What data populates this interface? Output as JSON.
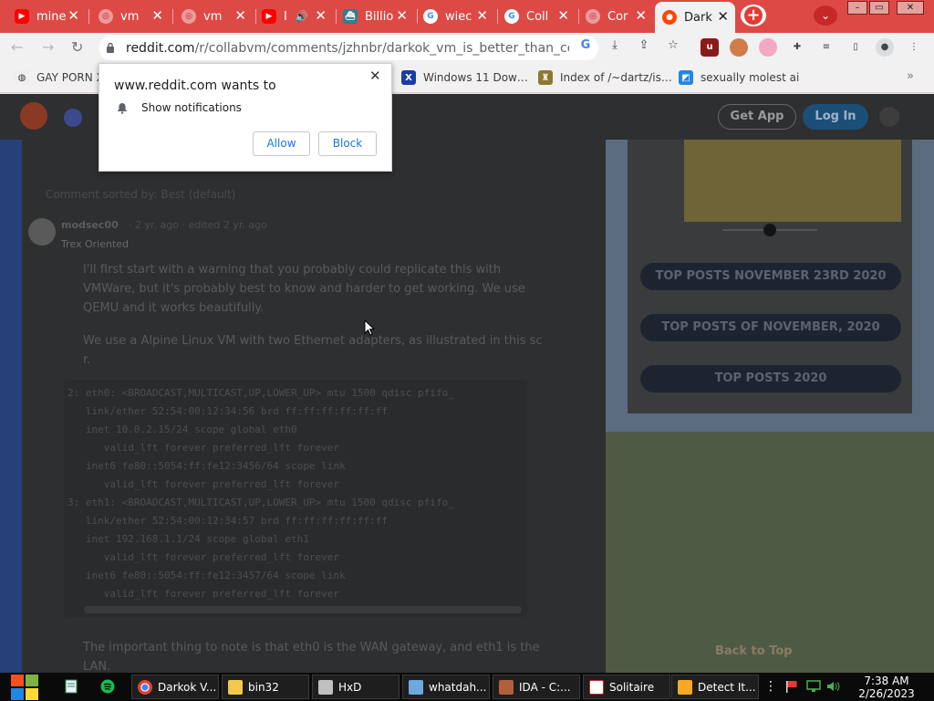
{
  "tabs": [
    {
      "label": "mine",
      "icon": "youtube-icon",
      "color": "#ff0000"
    },
    {
      "label": "vm",
      "icon": "generic-site-icon",
      "color": "#e57373"
    },
    {
      "label": "vm",
      "icon": "generic-site-icon",
      "color": "#e57373"
    },
    {
      "label": "I",
      "icon": "youtube-icon",
      "color": "#ff0000"
    },
    {
      "label": "Billio",
      "icon": "ship-icon",
      "color": "#2e7d91"
    },
    {
      "label": "wiec",
      "icon": "google-icon",
      "color": "#ffffff"
    },
    {
      "label": "Coll",
      "icon": "google-icon",
      "color": "#ffffff"
    },
    {
      "label": "Cor",
      "icon": "generic-site-icon",
      "color": "#e57373"
    },
    {
      "label": "Dark",
      "icon": "reddit-icon",
      "color": "#ff4500",
      "active": true
    }
  ],
  "address_bar": {
    "domain": "reddit.com",
    "path": "/r/collabvm/comments/jzhnbr/darkok_vm_is_better_than_collab…"
  },
  "bookmarks": [
    {
      "label": "GAY PORN X",
      "icon": "globe-icon"
    },
    {
      "label": "Windows 11 Dow…",
      "icon": "x-icon"
    },
    {
      "label": "Index of /~dartz/is…",
      "icon": "figure-icon"
    },
    {
      "label": "sexually molest ai",
      "icon": "blue-square-icon"
    }
  ],
  "notification_popup": {
    "title": "www.reddit.com wants to",
    "permission": "Show notifications",
    "allow_label": "Allow",
    "block_label": "Block"
  },
  "reddit_header": {
    "get_app": "Get App",
    "login": "Log In"
  },
  "comment": {
    "sorted_by": "Comment sorted by: Best (default)",
    "username": "modsec00",
    "meta": "· 2 yr. ago · edited 2 yr. ago",
    "flair": "Trex Oriented",
    "para1": [
      "I'll first start with a warning that you probably could replicate this with",
      "VMWare, but it's probably best to know and harder to get working. We use",
      "QEMU and it works beautifully."
    ],
    "para2": [
      "We use a Alpine Linux VM with two Ethernet adapters, as illustrated in this sc",
      "r."
    ],
    "code_lines": [
      "2: eth0: <BROADCAST,MULTICAST,UP,LOWER_UP> mtu 1500 qdisc pfifo_",
      "   link/ether 52:54:00:12:34:56 brd ff:ff:ff:ff:ff:ff",
      "   inet 10.0.2.15/24 scope global eth0",
      "      valid_lft forever preferred_lft forever",
      "   inet6 fe80::5054:ff:fe12:3456/64 scope link",
      "      valid_lft forever preferred_lft forever",
      "3: eth1: <BROADCAST,MULTICAST,UP,LOWER_UP> mtu 1500 qdisc pfifo_",
      "   link/ether 52:54:00:12:34:57 brd ff:ff:ff:ff:ff:ff",
      "   inet 192.168.1.1/24 scope global eth1",
      "      valid_lft forever preferred_lft forever",
      "   inet6 fe80::5054:ff:fe12:3457/64 scope link",
      "      valid_lft forever preferred_lft forever"
    ],
    "para3": [
      "The important thing to note is that eth0 is the WAN gateway, and eth1 is the",
      "LAN."
    ]
  },
  "sidebar": {
    "buttons": [
      "TOP POSTS NOVEMBER 23RD 2020",
      "TOP POSTS OF NOVEMBER, 2020",
      "TOP POSTS 2020"
    ],
    "back_to_top": "Back to Top"
  },
  "taskbar": {
    "items": [
      {
        "label": "Darkok V...",
        "icon": "chrome-icon"
      },
      {
        "label": "bin32",
        "icon": "folder-icon"
      },
      {
        "label": "HxD",
        "icon": "hxd-icon"
      },
      {
        "label": "whatdah...",
        "icon": "image-icon"
      },
      {
        "label": "IDA - C:...",
        "icon": "ida-icon"
      },
      {
        "label": "Solitaire",
        "icon": "cards-icon"
      },
      {
        "label": "Detect It...",
        "icon": "detect-icon"
      }
    ],
    "time": "7:38 AM",
    "date": "2/26/2023"
  },
  "colors": {
    "tabstrip": "#dd4a45",
    "reddit_orange": "#ff4500",
    "link_blue": "#1a73e8"
  }
}
